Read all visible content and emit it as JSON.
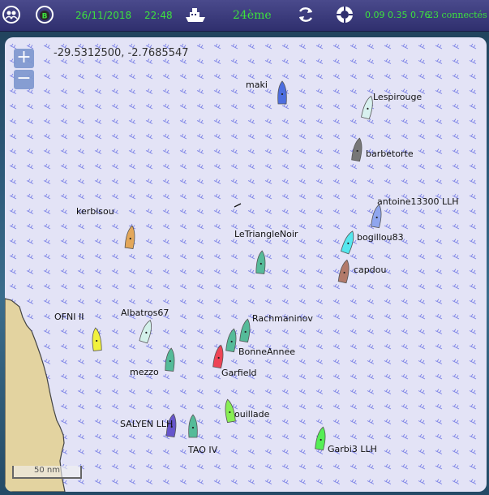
{
  "toolbar": {
    "date": "26/11/2018",
    "time": "22:48",
    "rank": "24ème",
    "stats": "0.09 0.35 0.76",
    "connected": "23 connectés",
    "icons": [
      "users-icon",
      "badge-b-icon",
      "boat-icon",
      "refresh-icon",
      "lifebuoy-icon"
    ]
  },
  "map": {
    "coordinates": "-29.5312500, -2.7685547",
    "zoom_in": "+",
    "zoom_out": "−",
    "scale": "50 nm"
  },
  "boats": [
    {
      "name": "maki",
      "color": "#4d6ee0"
    },
    {
      "name": "Lespirouge",
      "color": "#d8f1ef"
    },
    {
      "name": "barbetorte",
      "color": "#777777"
    },
    {
      "name": "antoine13300 LLH",
      "color": "#8fa6ee"
    },
    {
      "name": "kerbisou",
      "color": "#e3a75a"
    },
    {
      "name": "LeTriangleNoir",
      "color": "#55bb99"
    },
    {
      "name": "bogillou83",
      "color": "#55e7ee"
    },
    {
      "name": "capdou",
      "color": "#b27a6a"
    },
    {
      "name": "OFNI II",
      "color": "#f1f13d"
    },
    {
      "name": "Albatros67",
      "color": "#d3f1ea"
    },
    {
      "name": "Rachmaninov",
      "color": "#55bb99"
    },
    {
      "name": "BonneAnnee",
      "color": "#55bb99"
    },
    {
      "name": "Garfield",
      "color": "#ee4455"
    },
    {
      "name": "mezzo",
      "color": "#55bb99"
    },
    {
      "name": "ouillade",
      "color": "#88ee55"
    },
    {
      "name": "SALYEN LLH",
      "color": "#6655cc"
    },
    {
      "name": "TAO IV",
      "color": "#55bb99"
    },
    {
      "name": "Garbi3 LLH",
      "color": "#55ee55"
    }
  ]
}
